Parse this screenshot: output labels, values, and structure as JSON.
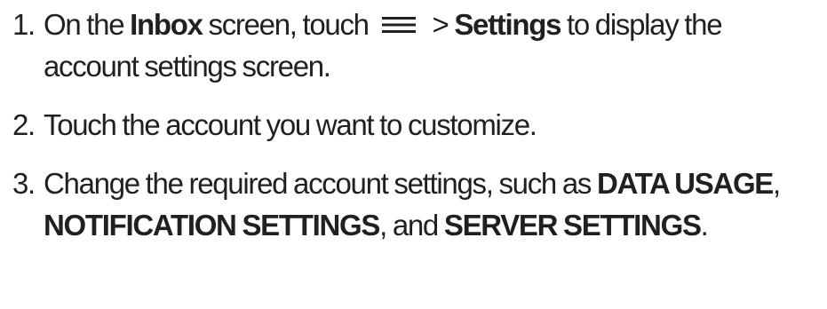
{
  "steps": [
    {
      "number": "1.",
      "text_a": "On the",
      "bold_a": "Inbox",
      "text_b": "screen, touch",
      "icon": "menu-icon",
      "text_c": ">",
      "bold_b": "Settings",
      "text_d": "to display the account settings screen."
    },
    {
      "number": "2.",
      "text_a": "Touch the account you want to customize."
    },
    {
      "number": "3.",
      "text_a": "Change the required account settings, such as",
      "bold_a": "DATA USAGE",
      "sep_a": ",",
      "bold_b": "NOTIFICATION SETTINGS",
      "sep_b": ", and",
      "bold_c": "SERVER SETTINGS",
      "end": "."
    }
  ]
}
